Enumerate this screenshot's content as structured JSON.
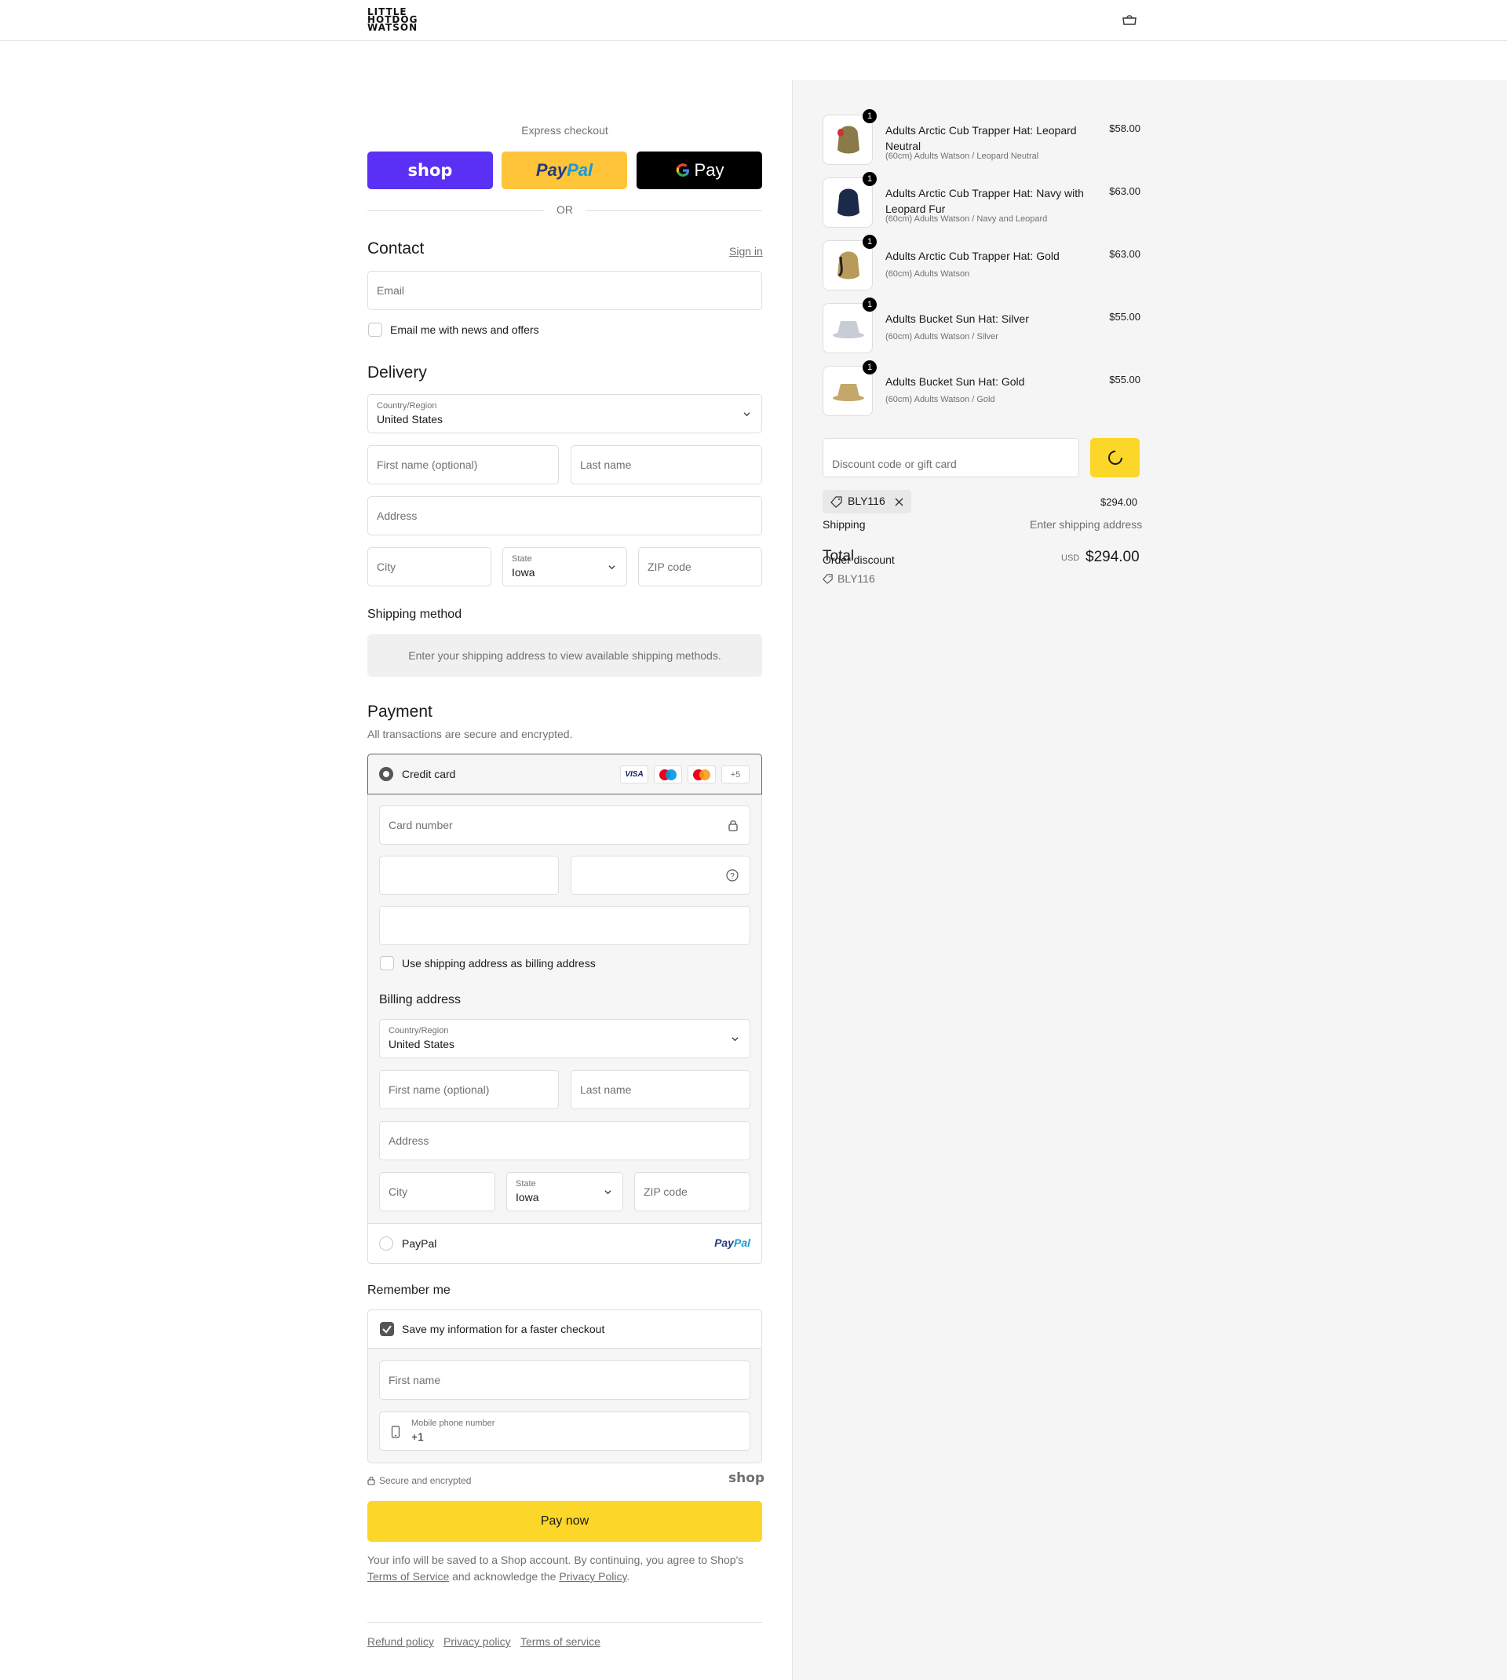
{
  "header": {
    "logo_lines": [
      "LITTLE",
      "HOTDOG",
      "WATSON"
    ]
  },
  "express": {
    "label": "Express checkout",
    "shop": "shop",
    "paypal_a": "Pay",
    "paypal_b": "Pal",
    "gpay": "Pay",
    "or": "OR"
  },
  "contact": {
    "title": "Contact",
    "sign_in": "Sign in",
    "email_placeholder": "Email",
    "news_label": "Email me with news and offers"
  },
  "delivery": {
    "title": "Delivery",
    "country_label": "Country/Region",
    "country_value": "United States",
    "first_name": "First name (optional)",
    "last_name": "Last name",
    "address": "Address",
    "city": "City",
    "state_label": "State",
    "state_value": "Iowa",
    "zip": "ZIP code"
  },
  "shipping": {
    "title": "Shipping method",
    "note": "Enter your shipping address to view available shipping methods."
  },
  "payment": {
    "title": "Payment",
    "subtitle": "All transactions are secure and encrypted.",
    "credit_card": "Credit card",
    "card_logos": [
      "VISA",
      "",
      "",
      "+5"
    ],
    "card_number": "Card number",
    "use_shipping": "Use shipping address as billing address",
    "billing_title": "Billing address",
    "country_label": "Country/Region",
    "country_value": "United States",
    "first_name": "First name (optional)",
    "last_name": "Last name",
    "address": "Address",
    "city": "City",
    "state_label": "State",
    "state_value": "Iowa",
    "zip": "ZIP code",
    "paypal": "PayPal",
    "paypal_logo_a": "Pay",
    "paypal_logo_b": "Pal"
  },
  "remember": {
    "title": "Remember me",
    "save_label": "Save my information for a faster checkout",
    "first_name": "First name",
    "phone_label": "Mobile phone number",
    "phone_value": "+1",
    "secure": "Secure and encrypted",
    "shop": "shop"
  },
  "pay_now": "Pay now",
  "legal": {
    "text1": "Your info will be saved to a Shop account. By continuing, you agree to Shop's",
    "terms": "Terms of Service",
    "text2": "and acknowledge the",
    "privacy": "Privacy Policy",
    "text3": "."
  },
  "footer": {
    "links": [
      "Refund policy",
      "Privacy policy",
      "Terms of service"
    ]
  },
  "summary": {
    "items": [
      {
        "name": "Adults Arctic Cub Trapper Hat: Leopard Neutral",
        "variant": "(60cm) Adults Watson / Leopard Neutral",
        "price": "$58.00",
        "qty": "1",
        "color": "#8a7a4a"
      },
      {
        "name": "Adults Arctic Cub Trapper Hat: Navy with Leopard Fur",
        "variant": "(60cm) Adults Watson / Navy and Leopard",
        "price": "$63.00",
        "qty": "1",
        "color": "#1c2a4a"
      },
      {
        "name": "Adults Arctic Cub Trapper Hat: Gold",
        "variant": "(60cm) Adults Watson",
        "price": "$63.00",
        "qty": "1",
        "color": "#b89a5a"
      },
      {
        "name": "Adults Bucket Sun Hat: Silver",
        "variant": "(60cm) Adults Watson / Silver",
        "price": "$55.00",
        "qty": "1",
        "color": "#c8ccd6"
      },
      {
        "name": "Adults Bucket Sun Hat: Gold",
        "variant": "(60cm) Adults Watson / Gold",
        "price": "$55.00",
        "qty": "1",
        "color": "#c4a86a"
      }
    ],
    "discount_placeholder": "Discount code or gift card",
    "code": "BLY116",
    "subtotal": "$294.00",
    "shipping_label": "Shipping",
    "shipping_value": "Enter shipping address",
    "total_label": "Total",
    "order_discount": "Order discount",
    "discount_code": "BLY116",
    "currency": "USD",
    "total": "$294.00"
  },
  "colors": {
    "accent": "#fcd628",
    "shop_purple": "#5a31f4",
    "paypal_yellow": "#ffc439"
  }
}
